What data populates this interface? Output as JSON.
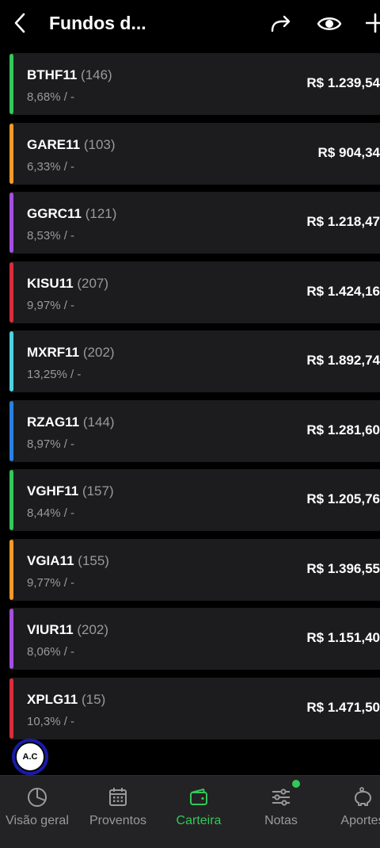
{
  "header": {
    "title": "Fundos d..."
  },
  "colors": {
    "green": "#34c759",
    "orange": "#f09a2b",
    "purple": "#a44fe0",
    "red": "#d92d3b",
    "cyan": "#4fd2e0",
    "blue": "#2b7fe0"
  },
  "funds": [
    {
      "ticker": "BTHF11",
      "qty": "(146)",
      "pct": "8,68% /  -",
      "value": "R$ 1.239,54",
      "color": "#34c759"
    },
    {
      "ticker": "GARE11",
      "qty": "(103)",
      "pct": "6,33% /  -",
      "value": "R$ 904,34",
      "color": "#f09a2b"
    },
    {
      "ticker": "GGRC11",
      "qty": "(121)",
      "pct": "8,53% /  -",
      "value": "R$ 1.218,47",
      "color": "#a44fe0"
    },
    {
      "ticker": "KISU11",
      "qty": "(207)",
      "pct": "9,97% /  -",
      "value": "R$ 1.424,16",
      "color": "#d92d3b"
    },
    {
      "ticker": "MXRF11",
      "qty": "(202)",
      "pct": "13,25% /  -",
      "value": "R$ 1.892,74",
      "color": "#4fd2e0"
    },
    {
      "ticker": "RZAG11",
      "qty": "(144)",
      "pct": "8,97% /  -",
      "value": "R$ 1.281,60",
      "color": "#2b7fe0"
    },
    {
      "ticker": "VGHF11",
      "qty": "(157)",
      "pct": "8,44% /  -",
      "value": "R$ 1.205,76",
      "color": "#34c759"
    },
    {
      "ticker": "VGIA11",
      "qty": "(155)",
      "pct": "9,77% /  -",
      "value": "R$ 1.396,55",
      "color": "#f09a2b"
    },
    {
      "ticker": "VIUR11",
      "qty": "(202)",
      "pct": "8,06% /  -",
      "value": "R$ 1.151,40",
      "color": "#a44fe0"
    },
    {
      "ticker": "XPLG11",
      "qty": "(15)",
      "pct": "10,3% /  -",
      "value": "R$ 1.471,50",
      "color": "#d92d3b"
    }
  ],
  "avatar": {
    "text": "A.C"
  },
  "nav": {
    "items": [
      {
        "label": "Visão geral",
        "icon": "pie-chart-icon"
      },
      {
        "label": "Proventos",
        "icon": "calendar-icon"
      },
      {
        "label": "Carteira",
        "icon": "wallet-icon"
      },
      {
        "label": "Notas",
        "icon": "sliders-icon"
      },
      {
        "label": "Aportes",
        "icon": "piggy-bank-icon"
      }
    ],
    "active": "Carteira"
  }
}
